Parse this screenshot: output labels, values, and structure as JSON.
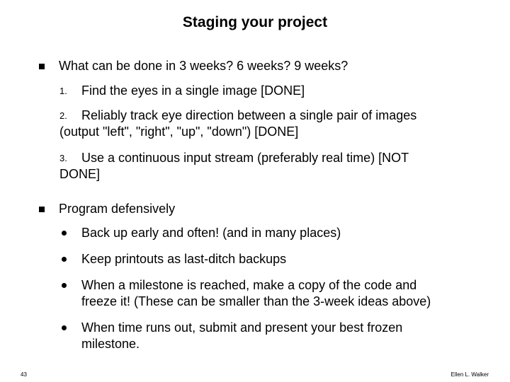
{
  "slide": {
    "title": "Staging your project",
    "bullets": [
      {
        "text": "What can be done in 3 weeks?  6 weeks?  9 weeks?",
        "subitems": [
          {
            "marker": "1.",
            "lines": [
              "Find the eyes in a single image [DONE]"
            ]
          },
          {
            "marker": "2.",
            "lines": [
              "Reliably track eye direction between a single pair of images",
              "(output \"left\", \"right\", \"up\", \"down\") [DONE]"
            ]
          },
          {
            "marker": "3.",
            "lines": [
              "Use a continuous input stream (preferably real time) [NOT",
              "DONE]"
            ]
          }
        ]
      },
      {
        "text": "Program defensively",
        "subitems": [
          {
            "marker": "bullet",
            "lines": [
              "Back up early and often!  (and in many places)"
            ]
          },
          {
            "marker": "bullet",
            "lines": [
              "Keep printouts as last-ditch backups"
            ]
          },
          {
            "marker": "bullet",
            "lines": [
              "When a milestone is reached, make a copy of the code and",
              "freeze it!  (These can be smaller than the 3-week ideas above)"
            ]
          },
          {
            "marker": "bullet",
            "lines": [
              "When time runs out, submit and present your best frozen",
              "milestone."
            ]
          }
        ]
      }
    ],
    "footer": {
      "page_number": "43",
      "author": "Ellen L. Walker"
    }
  }
}
